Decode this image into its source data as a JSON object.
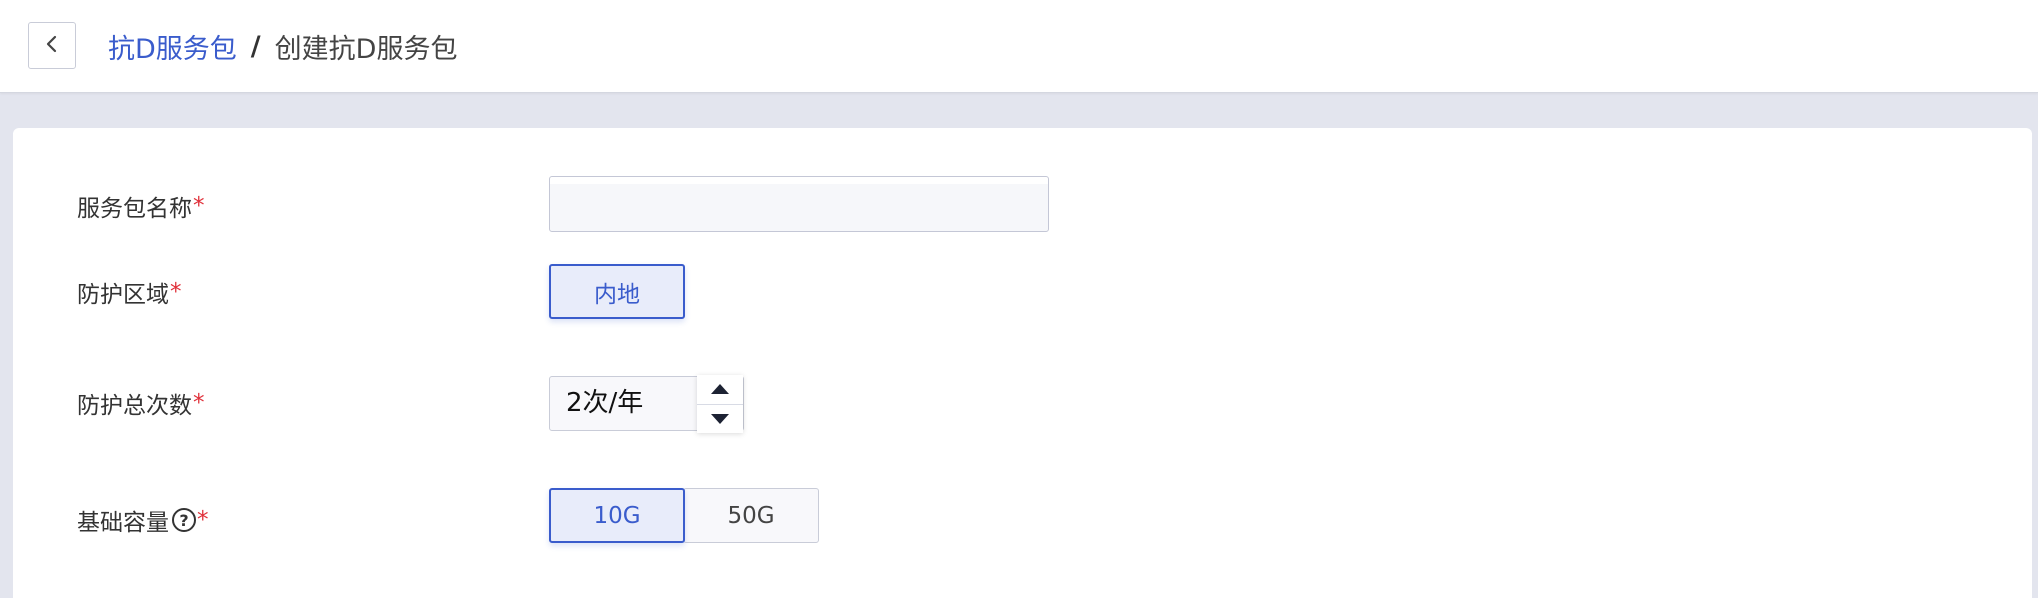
{
  "header": {
    "back_icon": "chevron-left-icon",
    "breadcrumb": {
      "parent": "抗D服务包",
      "separator": "/",
      "current": "创建抗D服务包"
    }
  },
  "form": {
    "name": {
      "label": "服务包名称",
      "required": "*",
      "value": "",
      "placeholder": ""
    },
    "region": {
      "label": "防护区域",
      "required": "*",
      "options": [
        "内地"
      ],
      "selected": "内地"
    },
    "count": {
      "label": "防护总次数",
      "required": "*",
      "value": "2次/年",
      "up_icon": "triangle-up-icon",
      "down_icon": "triangle-down-icon"
    },
    "capacity": {
      "label": "基础容量",
      "help_icon": "question-circle-icon",
      "help_glyph": "?",
      "required": "*",
      "options": [
        "10G",
        "50G"
      ],
      "selected": "10G"
    }
  },
  "colors": {
    "accent": "#3a5ccc",
    "required": "#e0303a",
    "page_bg": "#e3e5ee",
    "selected_bg": "#e8ecfa"
  }
}
